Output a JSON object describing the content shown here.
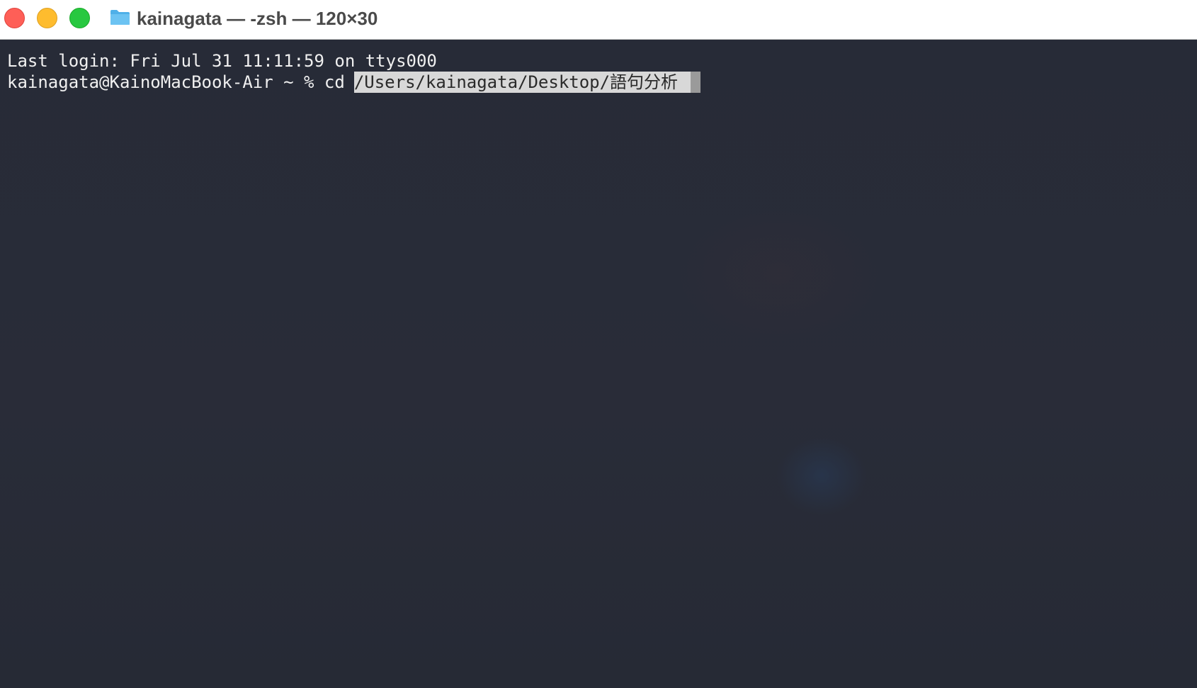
{
  "window": {
    "title": "kainagata — -zsh — 120×30",
    "colors": {
      "close": "#fe5f57",
      "minimize": "#febc2e",
      "zoom": "#28c840",
      "terminal_background": "#272b37",
      "text": "#f0f0f0",
      "selection": "#d8d8d8"
    },
    "icons": {
      "title_icon": "folder-icon"
    }
  },
  "terminal": {
    "last_login_line": "Last login: Fri Jul 31 11:11:59 on ttys000",
    "prompt": "kainagata@KainoMacBook-Air ~ % cd",
    "selected_path": "/Users/kainagata/Desktop/語句分析"
  }
}
